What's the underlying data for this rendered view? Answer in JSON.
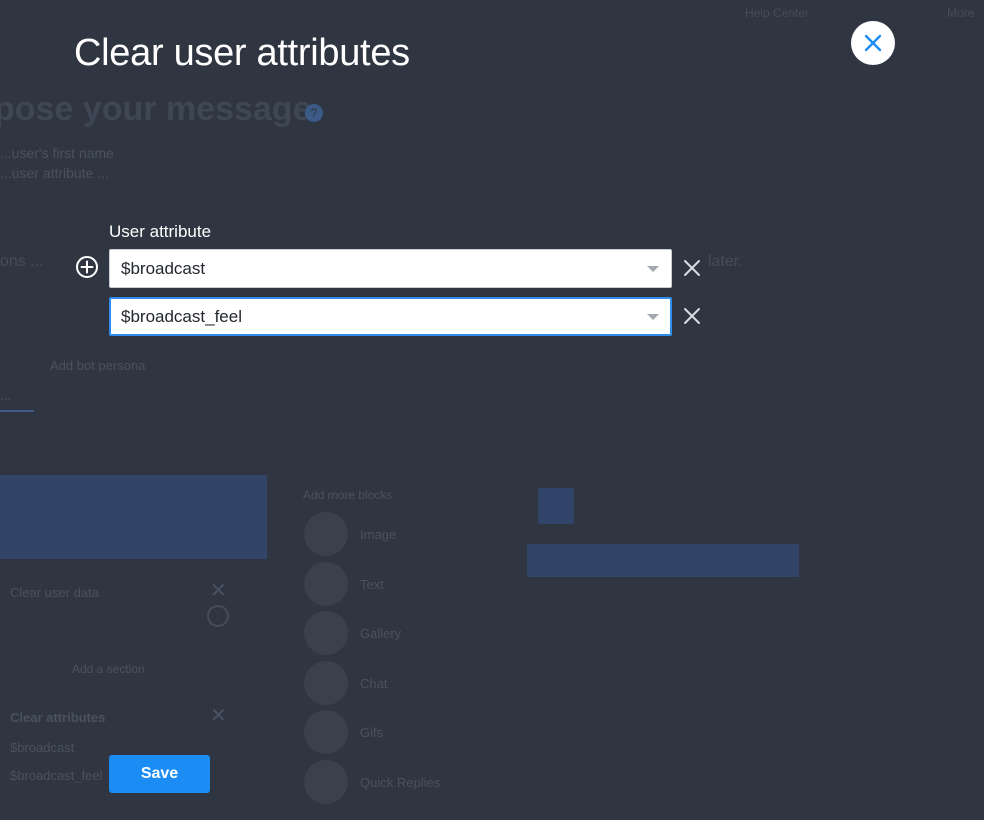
{
  "modal": {
    "title": "Clear user attributes",
    "field_label": "User attribute",
    "rows": [
      {
        "value": "$broadcast",
        "focused": false
      },
      {
        "value": "$broadcast_feel",
        "focused": true
      }
    ],
    "save_label": "Save"
  },
  "icons": {
    "close": "close-icon",
    "add": "plus-circle-icon",
    "remove": "x-icon",
    "dropdown": "caret-down-icon"
  },
  "colors": {
    "overlay": "#2f3541",
    "accent": "#1c8cf5",
    "focus_border": "#2d8ef0"
  },
  "background": {
    "heading": "pose your message",
    "tab_label": "Add bot persona",
    "clear_user_data": "Clear user data",
    "add_section": "Add a section",
    "clear_attributes": "Clear attributes",
    "attribute_1": "$broadcast",
    "attribute_2": "$broadcast_feel",
    "blocks_title": "Add more blocks",
    "blocks": [
      "Image",
      "Text",
      "Gallery",
      "Chat",
      "Gifs",
      "Quick Replies"
    ]
  }
}
